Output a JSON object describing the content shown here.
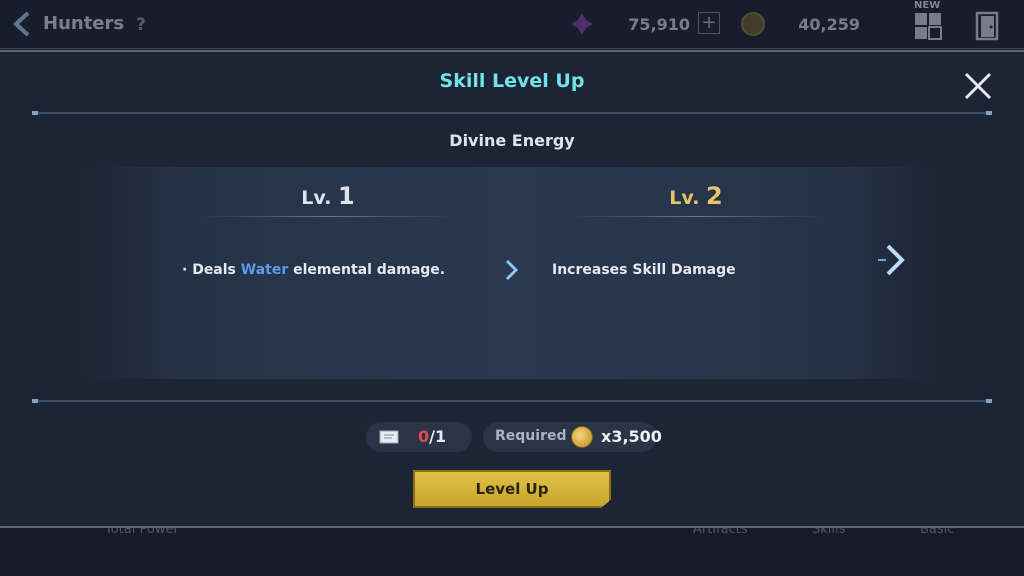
{
  "topbar": {
    "title": "Hunters",
    "help": "?",
    "gems": "75,910",
    "plus": "+",
    "gold": "40,259",
    "new_badge": "NEW"
  },
  "bottom": {
    "total_power": "Total Power",
    "tab_artifacts": "Artifacts",
    "tab_skills": "Skills",
    "tab_basic": "Basic"
  },
  "modal": {
    "title": "Skill Level Up",
    "skill_name": "Divine Energy",
    "current_level_prefix": "Lv.",
    "current_level_num": "1",
    "next_level_prefix": "Lv.",
    "next_level_num": "2",
    "current_desc_pre": "· Deals ",
    "current_desc_element": "Water",
    "current_desc_post": " elemental damage.",
    "next_desc": "Increases Skill Damage",
    "material_have": "0",
    "material_need": "/1",
    "required_label": "Required",
    "required_amount": "x3,500",
    "level_up_button": "Level Up"
  },
  "colors": {
    "title_cyan": "#6fe3e6",
    "next_level_gold": "#e6c56a",
    "water_blue": "#5a9cf0",
    "insufficient_red": "#e24a4a",
    "button_gold": "#d8b53c"
  }
}
